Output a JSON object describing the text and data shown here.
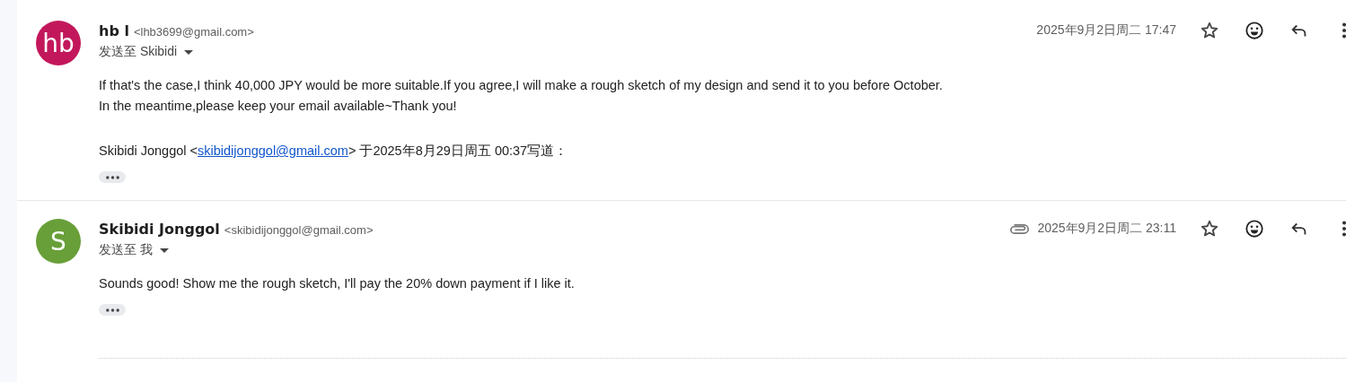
{
  "messages": [
    {
      "avatar": {
        "text": "hb",
        "color": "#c2185b"
      },
      "sender": "hb l",
      "email": "<lhb3699@gmail.com>",
      "recipient": "发送至 Skibidi",
      "attachment": false,
      "date": "2025年9月2日周二 17:47",
      "body": [
        {
          "kind": "text",
          "text": "If that's the case,I think 40,000 JPY would be more suitable.If you agree,I will make a rough sketch of my design and send it to you before October."
        },
        {
          "kind": "text",
          "text": "In the meantime,please keep your email available~Thank you!"
        },
        {
          "kind": "gap"
        },
        {
          "kind": "quote",
          "before": "Skibidi Jonggol <",
          "link": "skibidijonggol@gmail.com",
          "after": "> 于2025年8月29日周五 00:37写道："
        }
      ]
    },
    {
      "avatar": {
        "text": "S",
        "color": "#689f38"
      },
      "sender": "Skibidi Jonggol",
      "email": "<skibidijonggol@gmail.com>",
      "recipient": "发送至 我",
      "attachment": true,
      "date": "2025年9月2日周二 23:11",
      "body": [
        {
          "kind": "text",
          "text": "Sounds good! Show me the rough sketch, I'll pay the 20% down payment if I like it."
        }
      ]
    }
  ]
}
